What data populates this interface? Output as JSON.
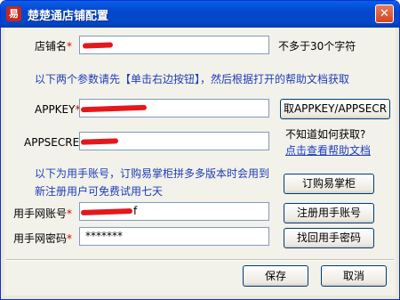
{
  "window": {
    "title": "楚楚通店铺配置",
    "close_glyph": "✕",
    "icon_glyph": "易"
  },
  "shop_name": {
    "label": "店铺名",
    "required_mark": "*",
    "value": "",
    "hint": "不多于30个字符"
  },
  "instructions_1": "以下两个参数请先【单击右边按钮】，然后根据打开的帮助文档获取",
  "appkey": {
    "label": "APPKEY",
    "required_mark": "*",
    "value": "",
    "button": "取APPKEY/APPSECR"
  },
  "appsecret": {
    "label": "APPSECRET",
    "required_mark": "*",
    "value": ""
  },
  "help": {
    "question": "不知道如何获取?",
    "link": "点击查看帮助文档"
  },
  "instructions_2": {
    "line1": "以下为用手账号，订购易掌柜拼多多版本时会用到",
    "line2": "新注册用户可免费试用七天"
  },
  "order_button": "订购易掌柜",
  "account": {
    "label": "用手网账号",
    "required_mark": "*",
    "value": "f",
    "button": "注册用手账号"
  },
  "password": {
    "label": "用手网密码",
    "required_mark": "*",
    "value": "*******",
    "button": "找回用手密码"
  },
  "footer": {
    "save": "保存",
    "cancel": "取消"
  }
}
